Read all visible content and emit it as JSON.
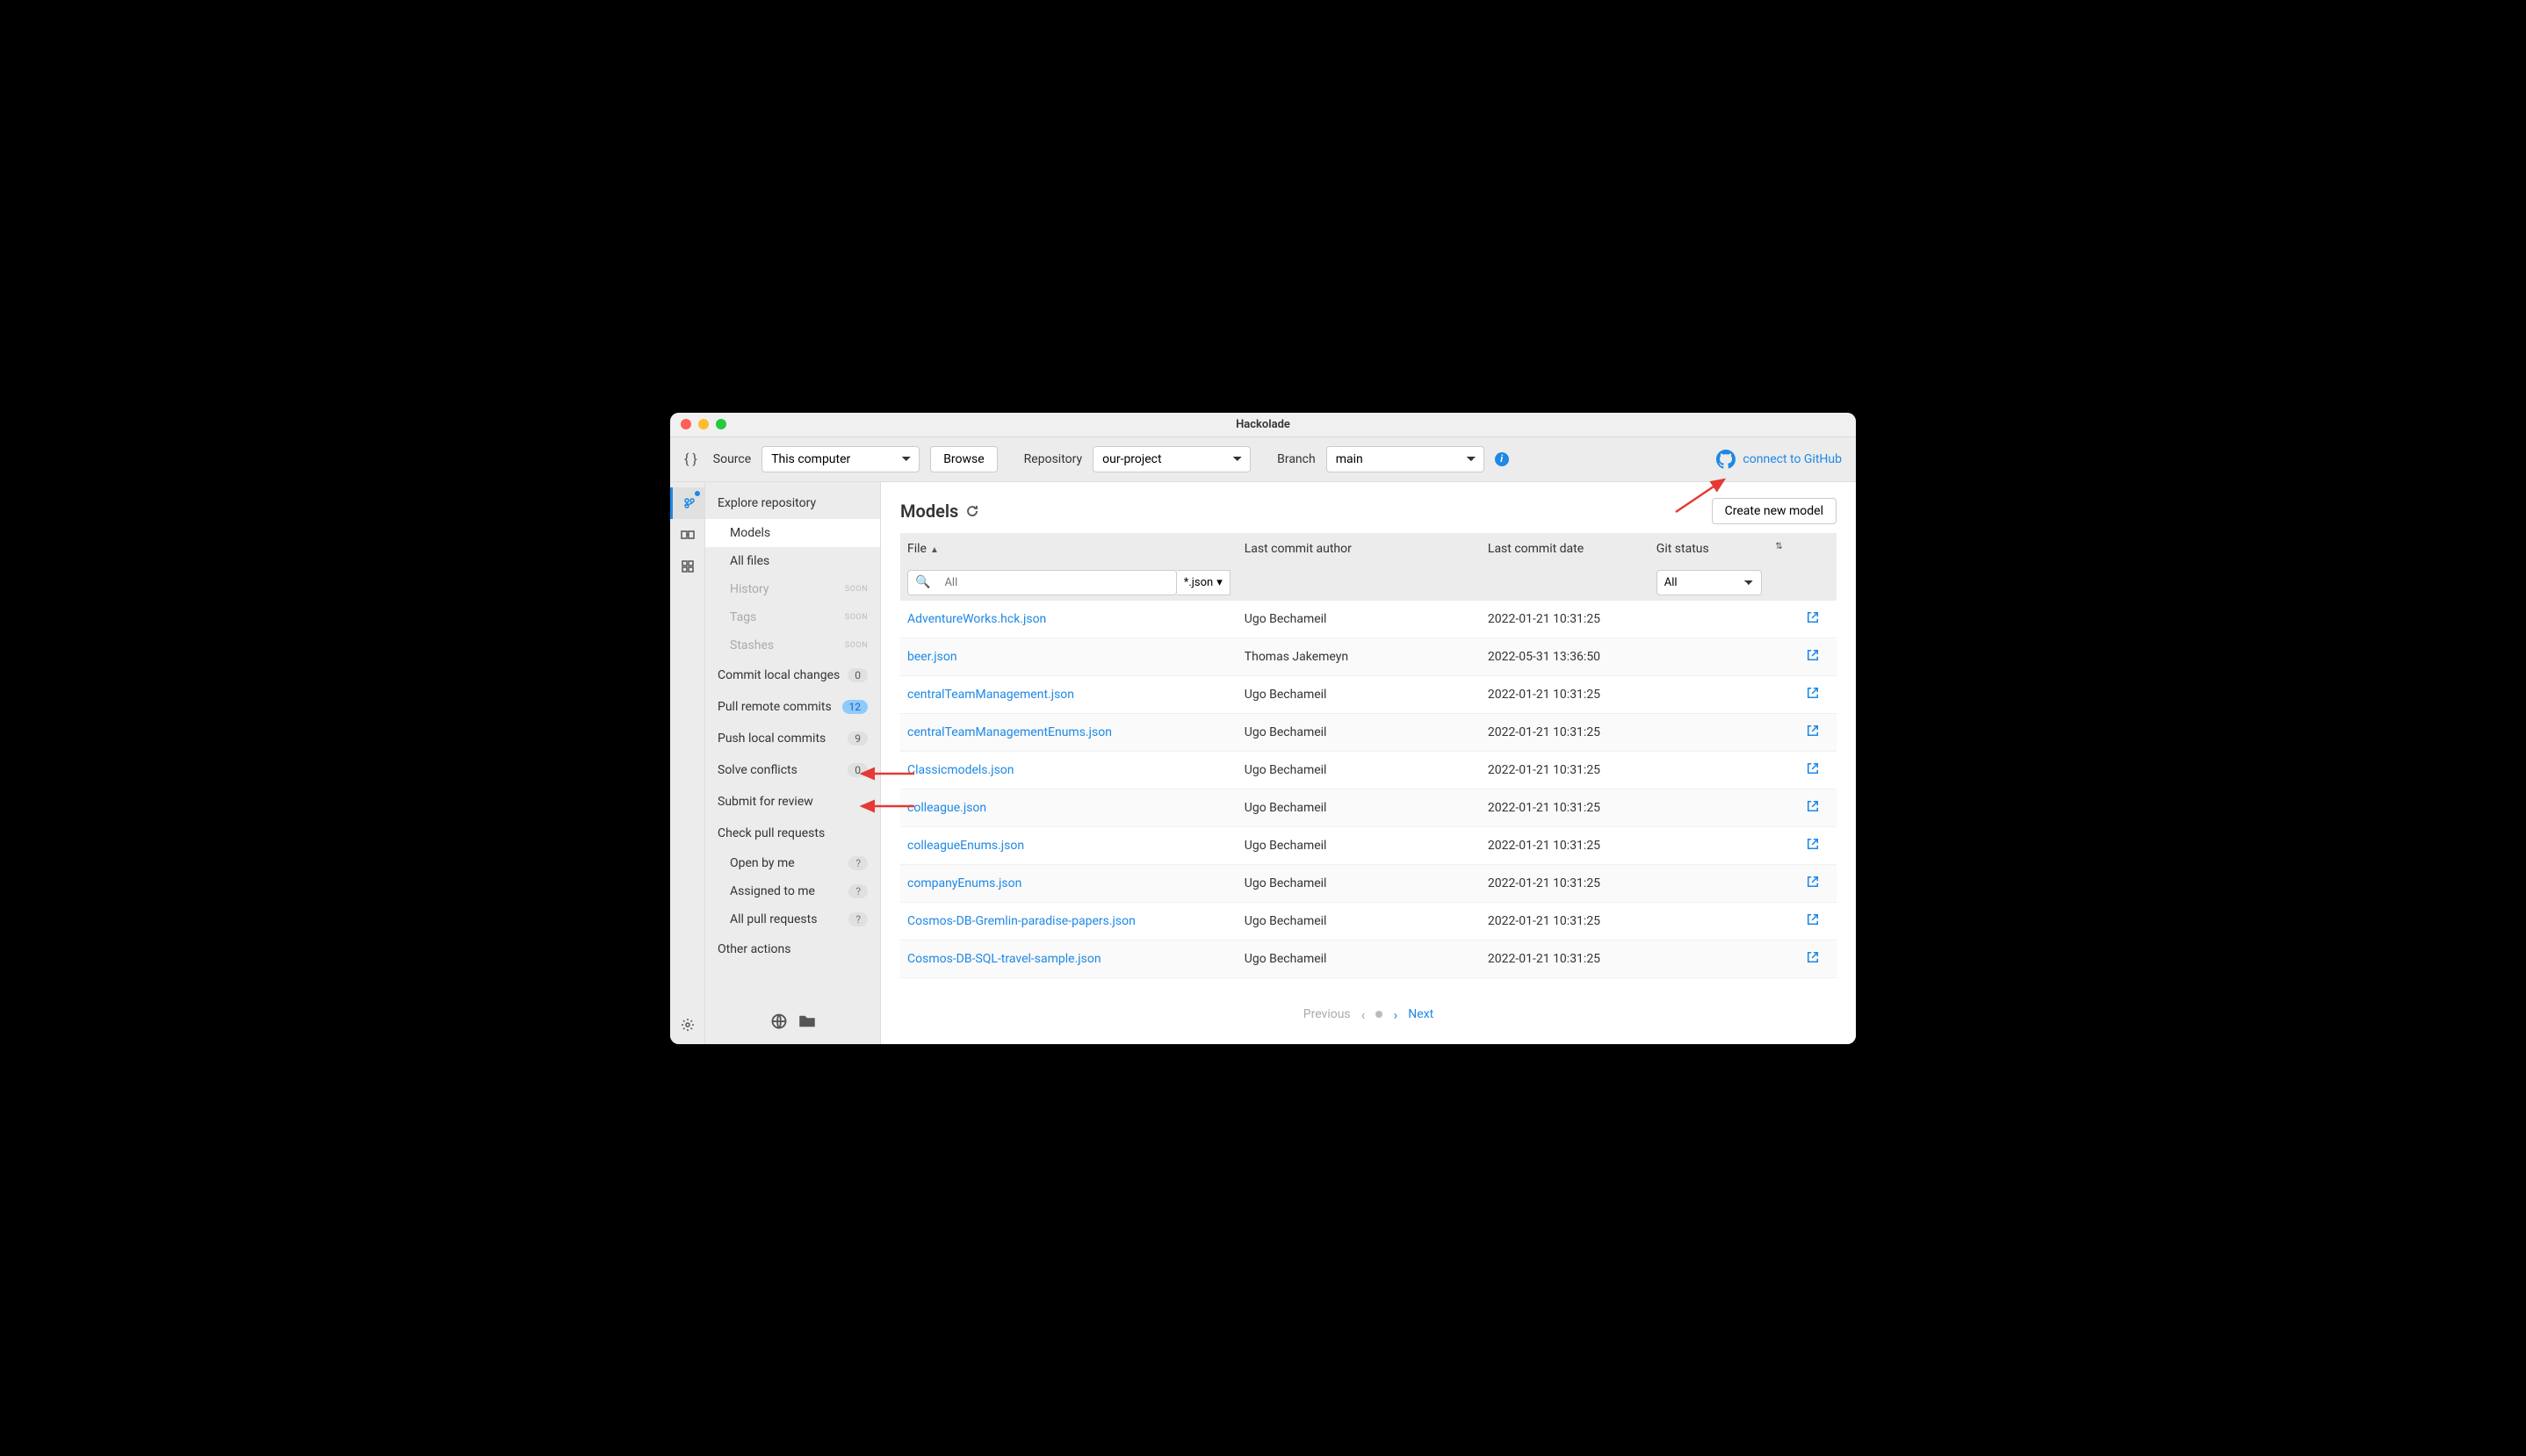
{
  "window": {
    "title": "Hackolade"
  },
  "toolbar": {
    "source_label": "Source",
    "source_value": "This computer",
    "browse_label": "Browse",
    "repository_label": "Repository",
    "repository_value": "our-project",
    "branch_label": "Branch",
    "branch_value": "main",
    "github_link": "connect to GitHub"
  },
  "sidebar": {
    "explore": "Explore repository",
    "models": "Models",
    "all_files": "All files",
    "history": "History",
    "tags": "Tags",
    "stashes": "Stashes",
    "soon": "SOON",
    "commit_local": "Commit local changes",
    "commit_local_count": "0",
    "pull_remote": "Pull remote commits",
    "pull_remote_count": "12",
    "push_local": "Push local commits",
    "push_local_count": "9",
    "solve_conflicts": "Solve conflicts",
    "solve_conflicts_count": "0",
    "submit_review": "Submit for review",
    "check_pr": "Check pull requests",
    "open_by_me": "Open by me",
    "assigned_to_me": "Assigned to me",
    "all_pr": "All pull requests",
    "q": "?",
    "other_actions": "Other actions"
  },
  "main": {
    "title": "Models",
    "create_button": "Create new model",
    "columns": {
      "file": "File",
      "author": "Last commit author",
      "date": "Last commit date",
      "status": "Git status"
    },
    "search_placeholder": "All",
    "ext_filter": "*.json",
    "status_filter": "All",
    "rows": [
      {
        "file": "AdventureWorks.hck.json",
        "author": "Ugo Bechameil",
        "date": "2022-01-21 10:31:25"
      },
      {
        "file": "beer.json",
        "author": "Thomas Jakemeyn",
        "date": "2022-05-31 13:36:50"
      },
      {
        "file": "centralTeamManagement.json",
        "author": "Ugo Bechameil",
        "date": "2022-01-21 10:31:25"
      },
      {
        "file": "centralTeamManagementEnums.json",
        "author": "Ugo Bechameil",
        "date": "2022-01-21 10:31:25"
      },
      {
        "file": "Classicmodels.json",
        "author": "Ugo Bechameil",
        "date": "2022-01-21 10:31:25"
      },
      {
        "file": "colleague.json",
        "author": "Ugo Bechameil",
        "date": "2022-01-21 10:31:25"
      },
      {
        "file": "colleagueEnums.json",
        "author": "Ugo Bechameil",
        "date": "2022-01-21 10:31:25"
      },
      {
        "file": "companyEnums.json",
        "author": "Ugo Bechameil",
        "date": "2022-01-21 10:31:25"
      },
      {
        "file": "Cosmos-DB-Gremlin-paradise-papers.json",
        "author": "Ugo Bechameil",
        "date": "2022-01-21 10:31:25"
      },
      {
        "file": "Cosmos-DB-SQL-travel-sample.json",
        "author": "Ugo Bechameil",
        "date": "2022-01-21 10:31:25"
      }
    ],
    "prev": "Previous",
    "next": "Next"
  }
}
